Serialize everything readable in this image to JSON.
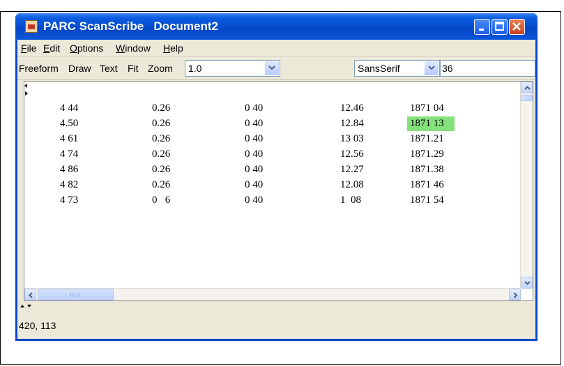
{
  "window": {
    "app_name": "PARC ScanScribe",
    "document_name": "Document2",
    "app_icon": "java-cup-icon"
  },
  "menubar": {
    "items": [
      {
        "mnemonic": "F",
        "rest": "ile"
      },
      {
        "mnemonic": "E",
        "rest": "dit"
      },
      {
        "mnemonic": "O",
        "rest": "ptions"
      },
      {
        "mnemonic": "W",
        "rest": "indow"
      },
      {
        "mnemonic": "H",
        "rest": "elp"
      }
    ]
  },
  "toolbar": {
    "freeform": "Freeform",
    "draw": "Draw",
    "text": "Text",
    "fit": "Fit",
    "zoom_label": "Zoom",
    "zoom_value": "1.0",
    "font_family": "SansSerif",
    "font_size": "36"
  },
  "table": {
    "rows": [
      [
        "4 44",
        "0.26",
        "0 40",
        "12.46",
        "1871 04"
      ],
      [
        "4.50",
        "0.26",
        "0 40",
        "12.84",
        "1871 13"
      ],
      [
        "4 61",
        "0.26",
        "0 40",
        "13 03",
        "1871.21"
      ],
      [
        "4 74",
        "0.26",
        "0 40",
        "12.56",
        "1871.29"
      ],
      [
        "4 86",
        "0.26",
        "0 40",
        "12.27",
        "1871.38"
      ],
      [
        "4 82",
        "0.26",
        "0 40",
        "12.08",
        "1871 46"
      ],
      [
        "4 73",
        "0 _6",
        "0 40",
        "1  08",
        "1871 54"
      ]
    ]
  },
  "colors": {
    "title_bar": "#0a47c8",
    "selection_highlight": "#86e07c"
  },
  "status": {
    "coordinates": "420, 113"
  }
}
